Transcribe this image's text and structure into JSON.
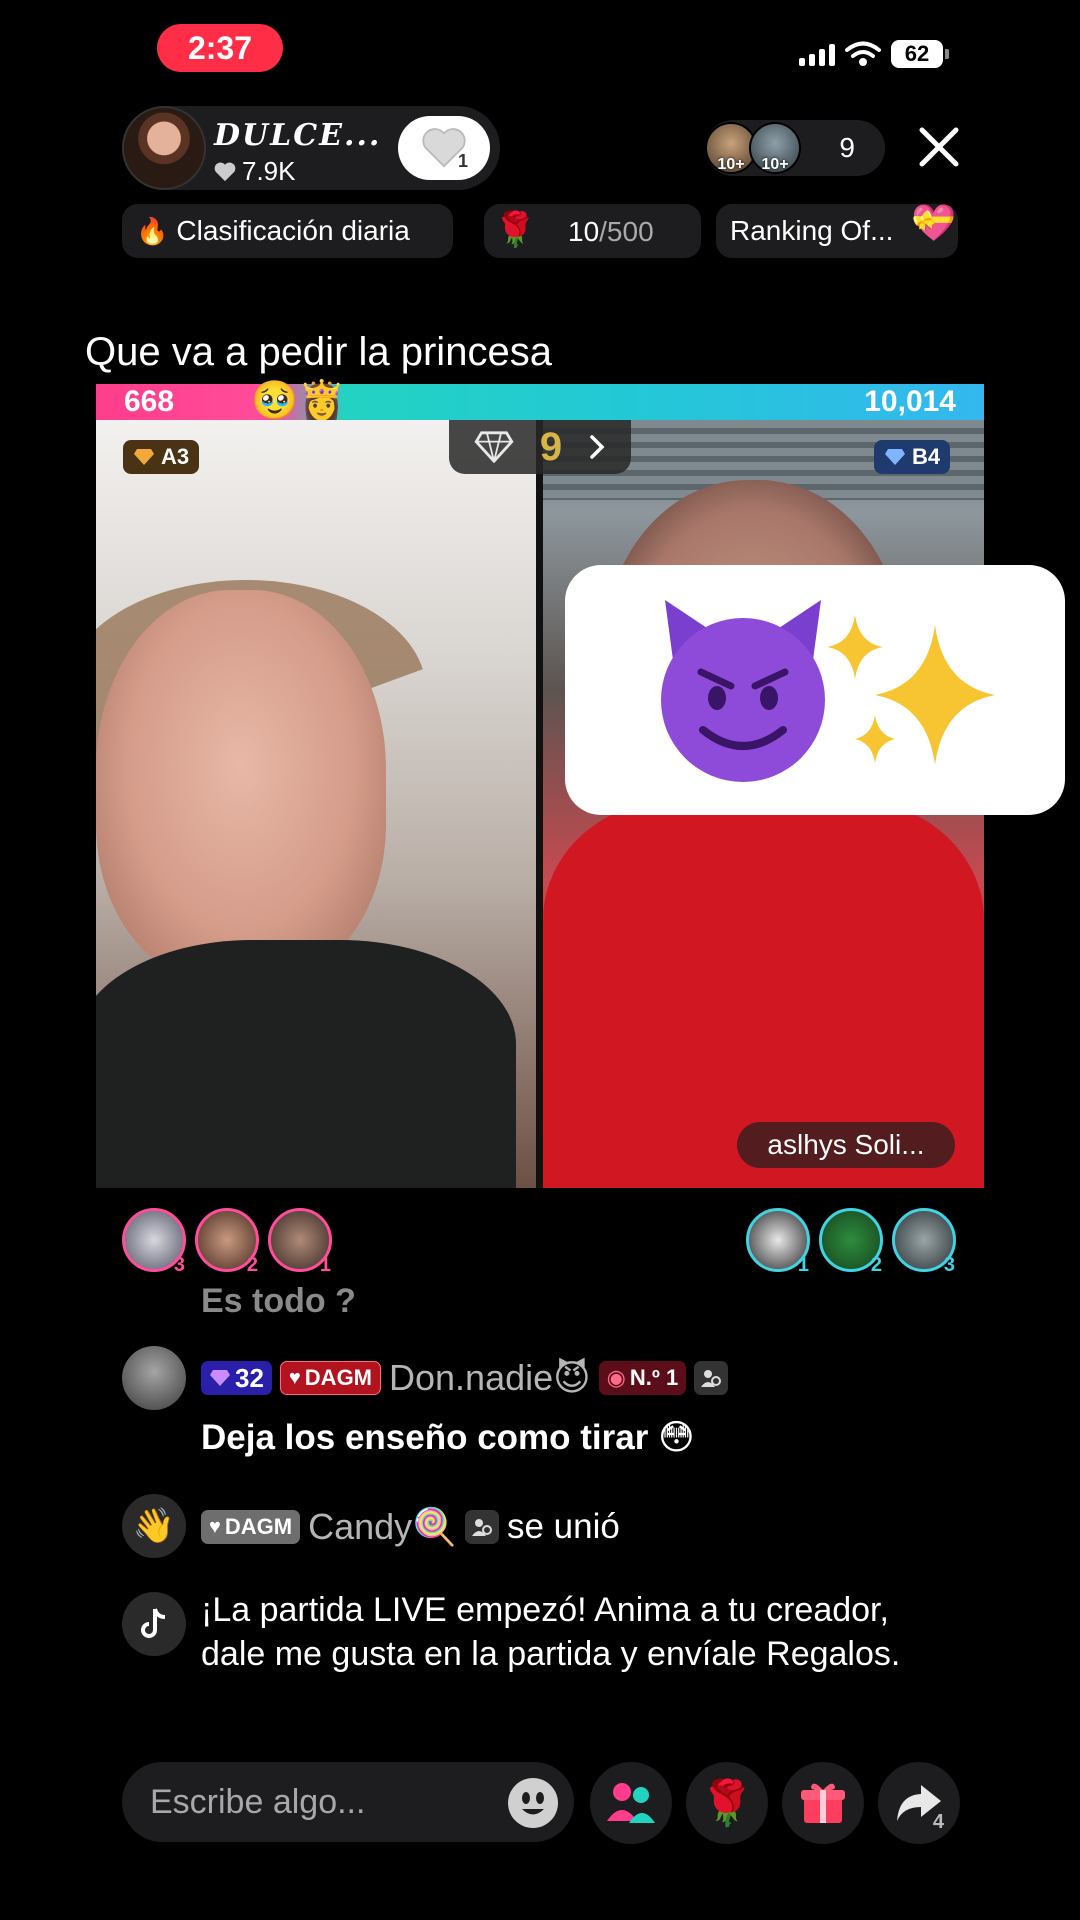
{
  "status_bar": {
    "time": "2:37",
    "battery": "62"
  },
  "host": {
    "name": "DULCE...",
    "likes": "7.9K",
    "follow_count": "1"
  },
  "viewers": {
    "av1_label": "10+",
    "av2_label": "10+",
    "count": "9"
  },
  "chips": {
    "daily_ranking": "Clasificación diaria",
    "goal_current": "10",
    "goal_total": "/500",
    "ranking_other": "Ranking Of..."
  },
  "stream_title": "Que va a pedir la princesa",
  "battle": {
    "score_left": "668",
    "score_right": "10,014",
    "left_share": 0.0625,
    "tag_left": "A3",
    "tag_right": "B4",
    "round": "9",
    "right_name": "aslhys Soli..."
  },
  "gifters": {
    "left": [
      {
        "rank": "3"
      },
      {
        "rank": "2"
      },
      {
        "rank": "1"
      }
    ],
    "right": [
      {
        "rank": "1"
      },
      {
        "rank": "2"
      },
      {
        "rank": "3"
      }
    ]
  },
  "chat": {
    "faded": "Es todo ?",
    "msg1": {
      "level": "32",
      "fan_club": "DAGM",
      "user": "Don.nadie😈",
      "no1": "N.º 1",
      "text": "Deja los enseño como tirar 😳"
    },
    "join": {
      "fan_club": "DAGM",
      "user": "Candy🍭",
      "text": "se unió"
    },
    "system": "¡La partida LIVE empezó! Anima a tu creador, dale me gusta en la partida y envíale Regalos."
  },
  "bottom": {
    "placeholder": "Escribe algo...",
    "share_count": "4"
  },
  "colors": {
    "live_red": "#ff2d46",
    "team_pink": "#ff4d9b",
    "team_blue": "#3fd3e3"
  }
}
